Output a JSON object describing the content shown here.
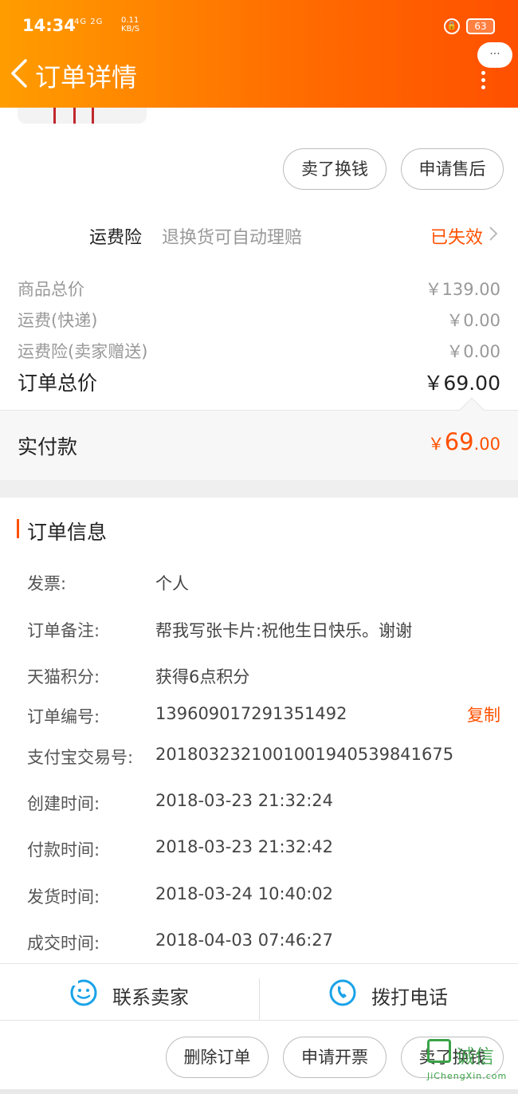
{
  "status_bar": {
    "time": "14:34",
    "network": "4G 2G",
    "speed_top": "0.11",
    "speed_unit": "KB/S",
    "lock_glyph": "🔒",
    "battery": "63"
  },
  "header": {
    "title": "订单详情",
    "more_glyph": "···"
  },
  "item_actions": {
    "sell": "卖了换钱",
    "after_sale": "申请售后"
  },
  "insurance": {
    "label": "运费险",
    "desc": "退换货可自动理赔",
    "status": "已失效"
  },
  "prices": [
    {
      "label": "商品总价",
      "value": "￥139.00"
    },
    {
      "label": "运费(快递)",
      "value": "￥0.00"
    },
    {
      "label": "运费险(卖家赠送)",
      "value": "￥0.00"
    }
  ],
  "order_total": {
    "label": "订单总价",
    "value": "￥69.00"
  },
  "paid": {
    "label": "实付款",
    "currency": "￥",
    "int": "69",
    "dec": ".00"
  },
  "order_info": {
    "title": "订单信息",
    "rows": [
      {
        "k": "发票:",
        "v": "个人"
      },
      {
        "k": "订单备注:",
        "v": "帮我写张卡片:祝他生日快乐。谢谢"
      },
      {
        "k": "天猫积分:",
        "v": "获得6点积分"
      },
      {
        "k": "订单编号:",
        "v": "139609017291351492"
      },
      {
        "k": "支付宝交易号:",
        "v": "2018032321001001940539841675"
      },
      {
        "k": "创建时间:",
        "v": "2018-03-23 21:32:24"
      },
      {
        "k": "付款时间:",
        "v": "2018-03-23 21:32:42"
      },
      {
        "k": "发货时间:",
        "v": "2018-03-24 10:40:02"
      },
      {
        "k": "成交时间:",
        "v": "2018-04-03 07:46:27"
      }
    ],
    "copy": "复制"
  },
  "contact": {
    "seller": "联系卖家",
    "phone": "拨打电话"
  },
  "bottom_actions": {
    "delete": "删除订单",
    "invoice": "申请开票",
    "sell": "卖了换钱"
  },
  "watermark": {
    "text": "诚信",
    "sub": "JiChengXin.com"
  },
  "colors": {
    "accent": "#ff5000",
    "header_start": "#ff9d00",
    "header_end": "#ff5000",
    "contact_icon": "#1aa3e8"
  }
}
